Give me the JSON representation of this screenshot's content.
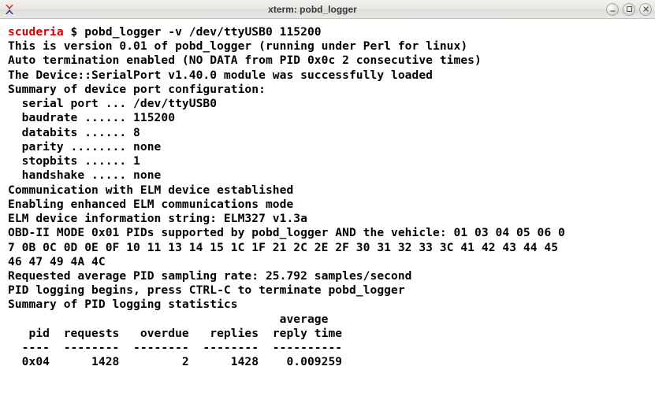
{
  "window": {
    "title": "xterm: pobd_logger"
  },
  "terminal": {
    "prompt_host": "scuderia",
    "prompt_sep": " $ ",
    "command": "pobd_logger -v /dev/ttyUSB0 115200",
    "lines": [
      "This is version 0.01 of pobd_logger (running under Perl for linux)",
      "Auto termination enabled (NO DATA from PID 0x0c 2 consecutive times)",
      "The Device::SerialPort v1.40.0 module was successfully loaded",
      "Summary of device port configuration:",
      "  serial port ... /dev/ttyUSB0",
      "  baudrate ...... 115200",
      "  databits ...... 8",
      "  parity ........ none",
      "  stopbits ...... 1",
      "  handshake ..... none",
      "Communication with ELM device established",
      "Enabling enhanced ELM communications mode",
      "ELM device information string: ELM327 v1.3a",
      "OBD-II MODE 0x01 PIDs supported by pobd_logger AND the vehicle: 01 03 04 05 06 0",
      "7 0B 0C 0D 0E 0F 10 11 13 14 15 1C 1F 21 2C 2E 2F 30 31 32 33 3C 41 42 43 44 45",
      "46 47 49 4A 4C",
      "Requested average PID sampling rate: 25.792 samples/second",
      "PID logging begins, press CTRL-C to terminate pobd_logger",
      "Summary of PID logging statistics",
      "                                       average",
      "   pid  requests   overdue   replies  reply time",
      "  ----  --------  --------  --------  ----------",
      "  0x04      1428         2      1428    0.009259"
    ]
  }
}
